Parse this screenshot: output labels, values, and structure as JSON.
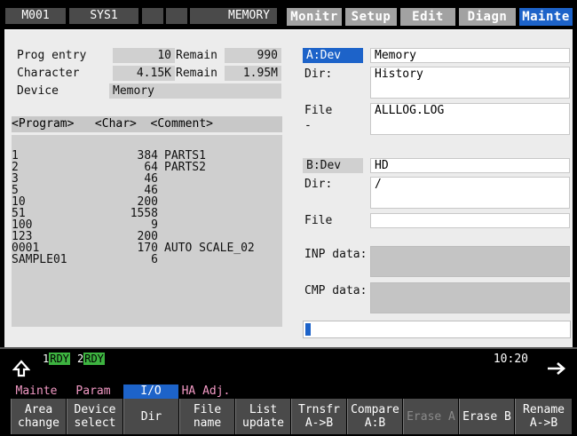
{
  "topbar": {
    "program": "M001",
    "system": "SYS1",
    "mode": "MEMORY",
    "tabs": [
      "Monitr",
      "Setup",
      "Edit",
      "Diagn",
      "Mainte"
    ],
    "active_tab": "Mainte"
  },
  "left": {
    "prog_entry_label": "Prog entry",
    "prog_entry_value": "10",
    "prog_remain_label": "Remain",
    "prog_remain_value": "990",
    "char_label": "Character",
    "char_value": "4.15K",
    "char_remain_label": "Remain",
    "char_remain_value": "1.95M",
    "device_label": "Device",
    "device_value": "Memory",
    "list_header": "<Program>   <Char>  <Comment>",
    "programs": [
      {
        "name": "1",
        "chars": "384",
        "comment": "PARTS1"
      },
      {
        "name": "2",
        "chars": "64",
        "comment": "PARTS2"
      },
      {
        "name": "3",
        "chars": "46",
        "comment": ""
      },
      {
        "name": "5",
        "chars": "46",
        "comment": ""
      },
      {
        "name": "10",
        "chars": "200",
        "comment": ""
      },
      {
        "name": "51",
        "chars": "1558",
        "comment": ""
      },
      {
        "name": "100",
        "chars": "9",
        "comment": ""
      },
      {
        "name": "123",
        "chars": "200",
        "comment": ""
      },
      {
        "name": "0001",
        "chars": "170",
        "comment": "AUTO SCALE_02"
      },
      {
        "name": "SAMPLE01",
        "chars": "6",
        "comment": ""
      }
    ]
  },
  "right": {
    "a_dev_label": "A:Dev",
    "a_dev_value": "Memory",
    "a_dir_label": "Dir:",
    "a_dir_value": "History",
    "a_file_label": "File",
    "a_file_value": "ALLLOG.LOG",
    "a_file_marker": "-",
    "b_dev_label": "B:Dev",
    "b_dev_value": "HD",
    "b_dir_label": "Dir:",
    "b_dir_value": "/",
    "b_file_label": "File",
    "b_file_value": "",
    "inp_label": "INP data:",
    "cmp_label": "CMP data:",
    "progress": 0.01
  },
  "status": {
    "rdy1_num": "1",
    "rdy1": "RDY",
    "rdy2_num": "2",
    "rdy2": "RDY",
    "time": "10:20"
  },
  "menu": {
    "tabs": [
      "Mainte",
      "Param",
      "I/O",
      "HA Adj."
    ],
    "keys": [
      {
        "l1": "Area",
        "l2": "change"
      },
      {
        "l1": "Device",
        "l2": "select"
      },
      {
        "l1": "Dir",
        "l2": ""
      },
      {
        "l1": "File",
        "l2": "name"
      },
      {
        "l1": "List",
        "l2": "update"
      },
      {
        "l1": "Trnsfr",
        "l2": "A->B"
      },
      {
        "l1": "Compare",
        "l2": "A:B"
      },
      {
        "l1": "Erase A",
        "l2": ""
      },
      {
        "l1": "Erase B",
        "l2": ""
      },
      {
        "l1": "Rename",
        "l2": "A->B"
      }
    ]
  },
  "colors": {
    "accent": "#1d63c9",
    "ready": "#3db340",
    "panel": "#ececec"
  }
}
